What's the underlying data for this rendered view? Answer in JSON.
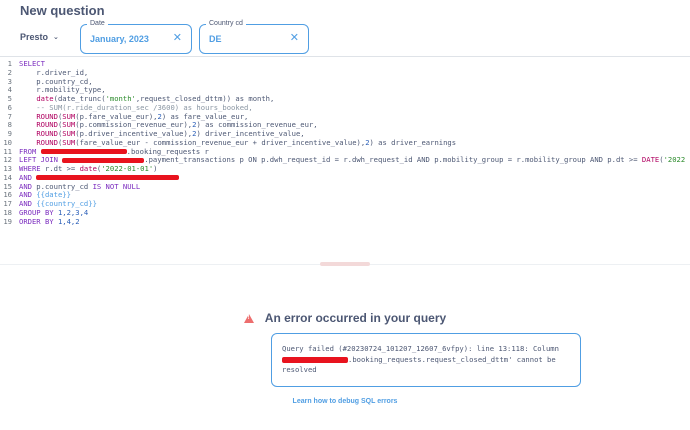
{
  "page": {
    "title": "New question"
  },
  "toolbar": {
    "database": "Presto"
  },
  "filters": [
    {
      "label": "Date",
      "value": "January, 2023"
    },
    {
      "label": "Country cd",
      "value": "DE"
    }
  ],
  "editor": {
    "line_numbers": [
      "1",
      "2",
      "3",
      "4",
      "5",
      "6",
      "7",
      "8",
      "9",
      "10",
      "11",
      "12",
      "13",
      "14",
      "15",
      "16",
      "17",
      "18",
      "19"
    ],
    "l1_select": "SELECT",
    "l2": "    r.driver_id,",
    "l3": "    p.country_cd,",
    "l4": "    r.mobility_type,",
    "l5_fn": "date",
    "l5_a": "(date_trunc(",
    "l5_str": "'month'",
    "l5_b": ",request_closed_dttm)) as month,",
    "l6_comment": "    -- SUM(r.ride_duration_sec /3600) as hours_booked,",
    "l7_fn": "ROUND",
    "l7_a": "(",
    "l7_fn2": "SUM",
    "l7_b": "(p.fare_value_eur),",
    "l7_num": "2",
    "l7_c": ") as fare_value_eur,",
    "l8_fn": "ROUND",
    "l8_a": "(",
    "l8_fn2": "SUM",
    "l8_b": "(p.commission_revenue_eur),",
    "l8_num": "2",
    "l8_c": ") as commission_revenue_eur,",
    "l9_fn": "ROUND",
    "l9_a": "(",
    "l9_fn2": "SUM",
    "l9_b": "(p.driver_incentive_value),",
    "l9_num": "2",
    "l9_c": ") driver_incentive_value,",
    "l10_fn": "ROUND",
    "l10_a": "(",
    "l10_fn2": "SUM",
    "l10_b": "(fare_value_eur - commission_revenue_eur + driver_incentive_value),",
    "l10_num": "2",
    "l10_c": ") as driver_earnings",
    "l11_kw": "FROM",
    "l11_b": ".booking_requests r",
    "l12_kw": "LEFT JOIN",
    "l12_b": ".payment_transactions p ON p.dwh_request_id = r.dwh_request_id AND p.mobility_group = r.mobility_group AND p.dt >= ",
    "l12_fn": "DATE",
    "l12_c": "(",
    "l12_str": "'2022",
    "l13_kw": "WHERE",
    "l13_b": " r.dt >= ",
    "l13_fn": "date",
    "l13_c": "(",
    "l13_str": "'2022-01-01'",
    "l13_d": ")",
    "l14_kw": "AND",
    "l15_kw": "AND",
    "l15_b": " p.country_cd ",
    "l15_kw2": "IS NOT NULL",
    "l16_kw": "AND",
    "l16_tpl": "{{date}}",
    "l17_kw": "AND",
    "l17_tpl": "{{country_cd}}",
    "l18_kw": "GROUP BY",
    "l18_b": "1,2,3,4",
    "l19_kw": "ORDER BY",
    "l19_b": "1,4,2"
  },
  "error": {
    "title": "An error occurred in your query",
    "line1": "Query failed (#20230724_101207_12607_6vfpy): line 13:118: Column",
    "line2": ".booking_requests.request_closed_dttm' cannot be",
    "line3": "resolved",
    "debug_link": "Learn how to debug SQL errors"
  },
  "colors": {
    "accent": "#509ee3",
    "error_icon": "#ed6e6e",
    "redaction": "#e8131e",
    "text": "#4c5773"
  }
}
